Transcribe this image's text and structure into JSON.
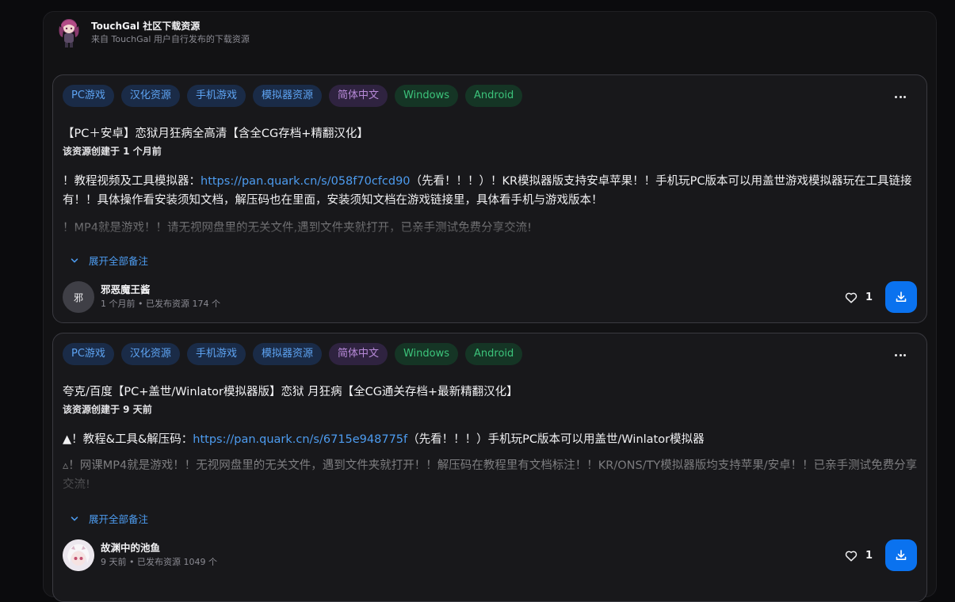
{
  "header": {
    "title": "TouchGal 社区下载资源",
    "subtitle": "来自 TouchGal 用户自行发布的下载资源"
  },
  "cards": [
    {
      "tags": [
        "PC游戏",
        "汉化资源",
        "手机游戏",
        "模拟器资源",
        "简体中文",
        "Windows",
        "Android"
      ],
      "title": "【PC＋安卓】恋狱月狂病全高清【含全CG存档+精翻汉化】",
      "created": "该资源创建于 1 个月前",
      "note_prefix": "！教程视频及工具模拟器：",
      "note_link": "https://pan.quark.cn/s/058f70cfcd90",
      "note_suffix": "（先看！！！）！KR模拟器版支持安卓苹果！！手机玩PC版本可以用盖世游戏模拟器玩在工具链接有！！具体操作看安装须知文档，解压码也在里面，安装须知文档在游戏链接里，具体看手机与游戏版本！",
      "note_faded": "！MP4就是游戏！！请无视网盘里的无关文件,遇到文件夹就打开，已亲手测试免费分享交流!",
      "expand_label": "展开全部备注",
      "author_avatar_text": "邪",
      "author_name": "邪恶魔王酱",
      "author_meta": "1 个月前 • 已发布资源 174 个",
      "likes": "1"
    },
    {
      "tags": [
        "PC游戏",
        "汉化资源",
        "手机游戏",
        "模拟器资源",
        "简体中文",
        "Windows",
        "Android"
      ],
      "title": "夸克/百度【PC+盖世/Winlator模拟器版】恋狱 月狂病【全CG通关存档+最新精翻汉化】",
      "created": "该资源创建于 9 天前",
      "note_prefix": "▲！教程&工具&解压码：",
      "note_link": "https://pan.quark.cn/s/6715e948775f",
      "note_suffix": "（先看！！！）手机玩PC版本可以用盖世/Winlator模拟器",
      "note_faded": "▵！网课MP4就是游戏！！无视网盘里的无关文件，遇到文件夹就打开！！解压码在教程里有文档标注！！KR/ONS/TY模拟器版均支持苹果/安卓！！已亲手测试免费分享交流!",
      "expand_label": "展开全部备注",
      "author_avatar_text": "",
      "author_name": "故渊中的池鱼",
      "author_meta": "9 天前 • 已发布资源 1049 个",
      "likes": "1"
    }
  ],
  "colors": {
    "accent": "#0a72ef",
    "link": "#4d9cf0",
    "tag_blue_bg": "#1a2b47",
    "tag_purple_bg": "#2f2340",
    "tag_green_bg": "#153525"
  },
  "icons": [
    "more-icon",
    "chevron-down-icon",
    "heart-icon",
    "download-icon"
  ]
}
